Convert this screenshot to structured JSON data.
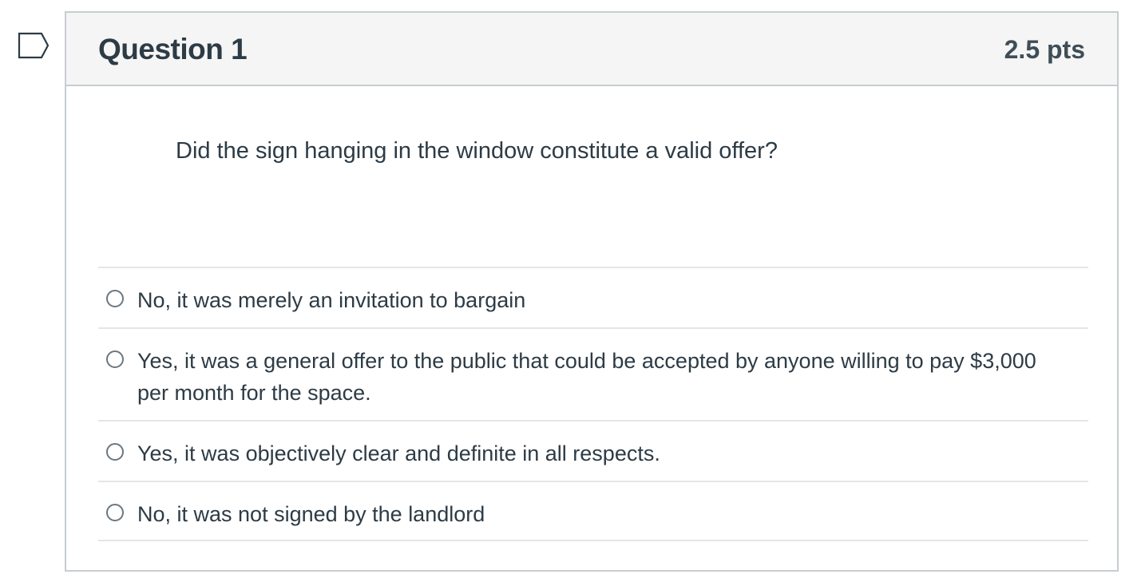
{
  "question": {
    "title": "Question 1",
    "points": "2.5 pts",
    "text": "Did the sign hanging in the window constitute a valid offer?"
  },
  "flag": {
    "icon": "flag-question-icon",
    "color": "#2d3b45"
  },
  "answers": [
    {
      "label": "No, it was merely an invitation to bargain",
      "selected": false
    },
    {
      "label": "Yes, it was a general offer to the public that could be accepted by anyone willing to pay $3,000 per month for the space.",
      "selected": false
    },
    {
      "label": "Yes, it was objectively clear and definite in all respects.",
      "selected": false
    },
    {
      "label": "No, it was not signed by the landlord",
      "selected": false
    }
  ]
}
